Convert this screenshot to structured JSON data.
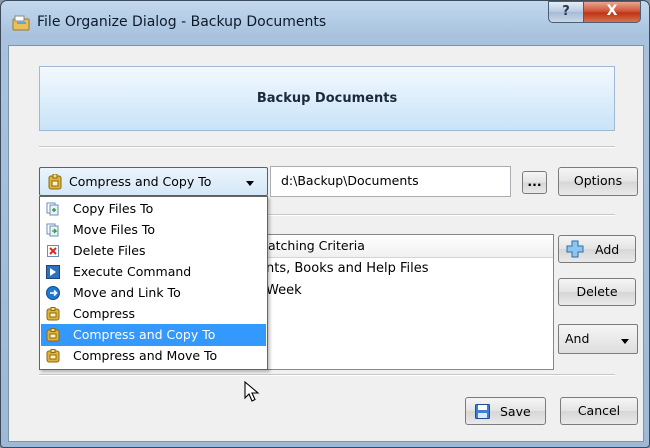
{
  "window": {
    "title": "File Organize Dialog - Backup Documents",
    "help_label": "?",
    "close_label": "X"
  },
  "header": {
    "title": "Backup Documents"
  },
  "action": {
    "selected": "Compress and Copy To",
    "path_value": "d:\\Backup\\Documents",
    "browse_label": "...",
    "options_label": "Options"
  },
  "dropdown": {
    "items": [
      {
        "label": "Copy Files To",
        "icon": "copy-files-icon"
      },
      {
        "label": "Move Files To",
        "icon": "move-files-icon"
      },
      {
        "label": "Delete Files",
        "icon": "delete-files-icon"
      },
      {
        "label": "Execute Command",
        "icon": "execute-command-icon"
      },
      {
        "label": "Move and Link To",
        "icon": "move-link-icon"
      },
      {
        "label": "Compress",
        "icon": "compress-icon"
      },
      {
        "label": "Compress and Copy To",
        "icon": "compress-copy-icon",
        "selected": true
      },
      {
        "label": "Compress and Move To",
        "icon": "compress-move-icon"
      }
    ]
  },
  "criteria": {
    "header": "atching Criteria",
    "rows": [
      "nts, Books and Help Files",
      "Week"
    ],
    "add_label": "Add",
    "delete_label": "Delete",
    "logic_value": "And"
  },
  "footer": {
    "save_label": "Save",
    "cancel_label": "Cancel"
  },
  "colors": {
    "selection": "#3399ff",
    "banner_top": "#f2f9ff",
    "banner_bottom": "#c9e3f7",
    "close_red": "#c63f22"
  }
}
